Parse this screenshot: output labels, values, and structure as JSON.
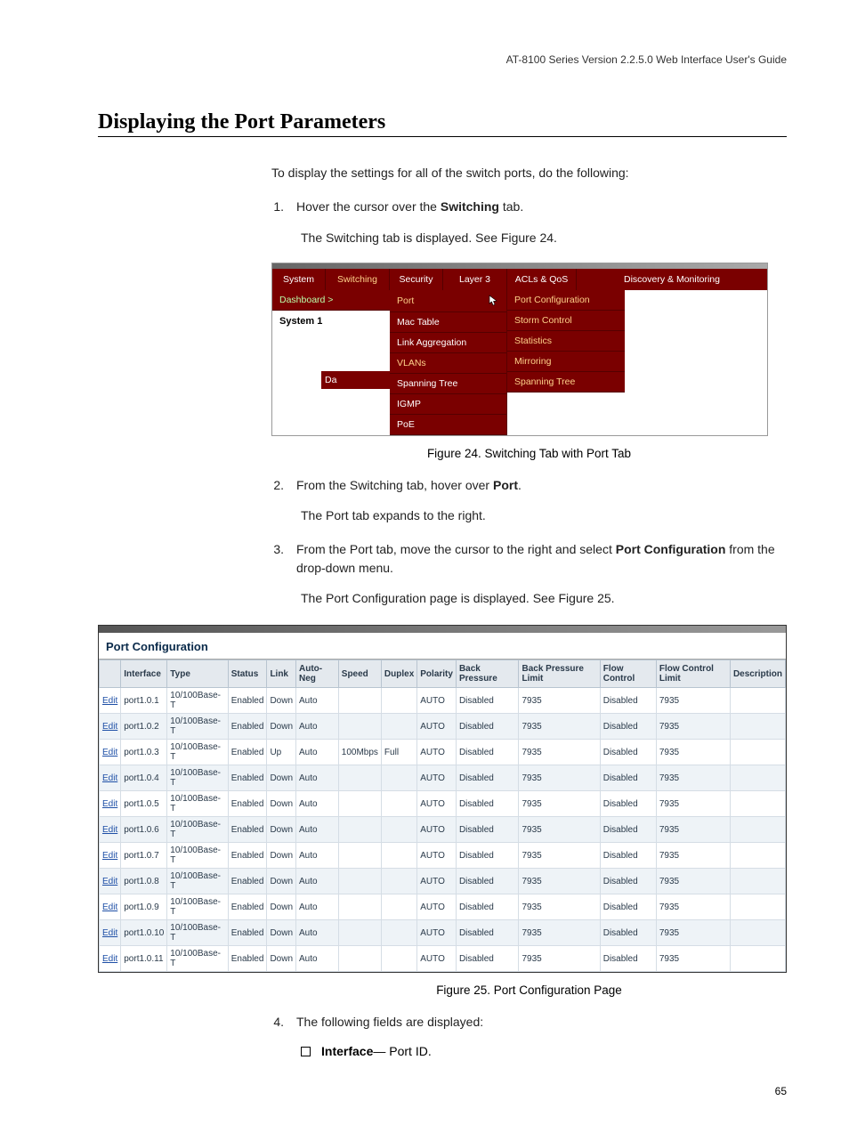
{
  "header": "AT-8100 Series Version 2.2.5.0 Web Interface User's Guide",
  "section_title": "Displaying the Port Parameters",
  "intro": "To display the settings for all of the switch ports, do the following:",
  "step1": {
    "n": "1.",
    "pre": "Hover the cursor over the ",
    "bold": "Switching",
    "post": " tab."
  },
  "sub1": "The Switching tab is displayed. See Figure 24.",
  "fig24_caption": "Figure 24. Switching Tab with Port Tab",
  "step2": {
    "n": "2.",
    "pre": "From the Switching tab, hover over ",
    "bold": "Port",
    "post": "."
  },
  "sub2": "The Port tab expands to the right.",
  "step3": {
    "n": "3.",
    "pre": "From the Port tab, move the cursor to the right and select ",
    "bold": "Port Configuration",
    "post": " from the drop-down menu."
  },
  "sub3": "The Port Configuration page is displayed. See Figure 25.",
  "fig25_caption": "Figure 25. Port Configuration Page",
  "step4": {
    "n": "4.",
    "text": "The following fields are displayed:"
  },
  "field_item": {
    "bold": "Interface",
    "rest": "— Port ID."
  },
  "page_num": "65",
  "tabs": {
    "system": "System",
    "switching": "Switching",
    "security": "Security",
    "layer3": "Layer 3",
    "acls": "ACLs & QoS",
    "discovery": "Discovery & Monitoring",
    "dashboard": "Dashboard >",
    "system1": "System 1",
    "da": "Da"
  },
  "menu_left": {
    "port": "Port",
    "mactable": "Mac Table",
    "linkagg": "Link Aggregation",
    "vlans": "VLANs",
    "spanning": "Spanning Tree",
    "igmp": "IGMP",
    "poe": "PoE"
  },
  "menu_right": {
    "portconfig": "Port Configuration",
    "storm": "Storm Control",
    "stats": "Statistics",
    "mirror": "Mirroring",
    "spanning": "Spanning Tree"
  },
  "pc_title": "Port Configuration",
  "pc_headers": [
    "",
    "Interface",
    "Type",
    "Status",
    "Link",
    "Auto-Neg",
    "Speed",
    "Duplex",
    "Polarity",
    "Back Pressure",
    "Back Pressure Limit",
    "Flow Control",
    "Flow Control Limit",
    "Description"
  ],
  "edit_label": "Edit",
  "pc_rows": [
    {
      "iface": "port1.0.1",
      "type": "10/100Base-T",
      "status": "Enabled",
      "link": "Down",
      "auto": "Auto",
      "speed": "",
      "duplex": "",
      "pol": "AUTO",
      "bp": "Disabled",
      "bpl": "7935",
      "fc": "Disabled",
      "fcl": "7935",
      "desc": ""
    },
    {
      "iface": "port1.0.2",
      "type": "10/100Base-T",
      "status": "Enabled",
      "link": "Down",
      "auto": "Auto",
      "speed": "",
      "duplex": "",
      "pol": "AUTO",
      "bp": "Disabled",
      "bpl": "7935",
      "fc": "Disabled",
      "fcl": "7935",
      "desc": ""
    },
    {
      "iface": "port1.0.3",
      "type": "10/100Base-T",
      "status": "Enabled",
      "link": "Up",
      "auto": "Auto",
      "speed": "100Mbps",
      "duplex": "Full",
      "pol": "AUTO",
      "bp": "Disabled",
      "bpl": "7935",
      "fc": "Disabled",
      "fcl": "7935",
      "desc": ""
    },
    {
      "iface": "port1.0.4",
      "type": "10/100Base-T",
      "status": "Enabled",
      "link": "Down",
      "auto": "Auto",
      "speed": "",
      "duplex": "",
      "pol": "AUTO",
      "bp": "Disabled",
      "bpl": "7935",
      "fc": "Disabled",
      "fcl": "7935",
      "desc": ""
    },
    {
      "iface": "port1.0.5",
      "type": "10/100Base-T",
      "status": "Enabled",
      "link": "Down",
      "auto": "Auto",
      "speed": "",
      "duplex": "",
      "pol": "AUTO",
      "bp": "Disabled",
      "bpl": "7935",
      "fc": "Disabled",
      "fcl": "7935",
      "desc": ""
    },
    {
      "iface": "port1.0.6",
      "type": "10/100Base-T",
      "status": "Enabled",
      "link": "Down",
      "auto": "Auto",
      "speed": "",
      "duplex": "",
      "pol": "AUTO",
      "bp": "Disabled",
      "bpl": "7935",
      "fc": "Disabled",
      "fcl": "7935",
      "desc": ""
    },
    {
      "iface": "port1.0.7",
      "type": "10/100Base-T",
      "status": "Enabled",
      "link": "Down",
      "auto": "Auto",
      "speed": "",
      "duplex": "",
      "pol": "AUTO",
      "bp": "Disabled",
      "bpl": "7935",
      "fc": "Disabled",
      "fcl": "7935",
      "desc": ""
    },
    {
      "iface": "port1.0.8",
      "type": "10/100Base-T",
      "status": "Enabled",
      "link": "Down",
      "auto": "Auto",
      "speed": "",
      "duplex": "",
      "pol": "AUTO",
      "bp": "Disabled",
      "bpl": "7935",
      "fc": "Disabled",
      "fcl": "7935",
      "desc": ""
    },
    {
      "iface": "port1.0.9",
      "type": "10/100Base-T",
      "status": "Enabled",
      "link": "Down",
      "auto": "Auto",
      "speed": "",
      "duplex": "",
      "pol": "AUTO",
      "bp": "Disabled",
      "bpl": "7935",
      "fc": "Disabled",
      "fcl": "7935",
      "desc": ""
    },
    {
      "iface": "port1.0.10",
      "type": "10/100Base-T",
      "status": "Enabled",
      "link": "Down",
      "auto": "Auto",
      "speed": "",
      "duplex": "",
      "pol": "AUTO",
      "bp": "Disabled",
      "bpl": "7935",
      "fc": "Disabled",
      "fcl": "7935",
      "desc": ""
    },
    {
      "iface": "port1.0.11",
      "type": "10/100Base-T",
      "status": "Enabled",
      "link": "Down",
      "auto": "Auto",
      "speed": "",
      "duplex": "",
      "pol": "AUTO",
      "bp": "Disabled",
      "bpl": "7935",
      "fc": "Disabled",
      "fcl": "7935",
      "desc": ""
    }
  ]
}
